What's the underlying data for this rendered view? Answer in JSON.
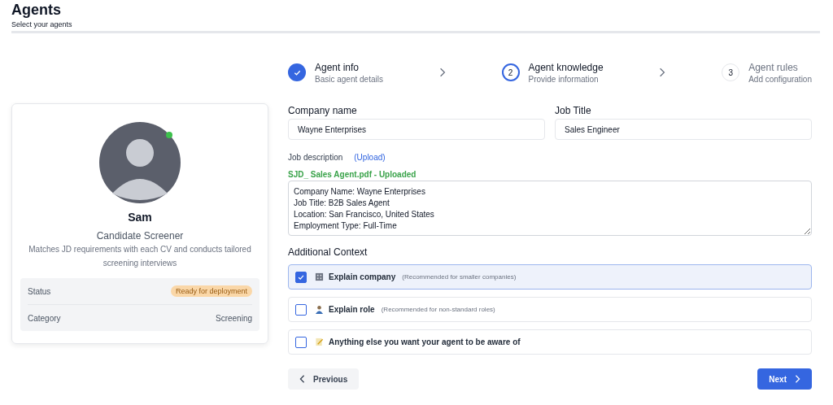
{
  "header": {
    "title": "Agents",
    "subtitle": "Select your agents"
  },
  "agent": {
    "online": true,
    "name": "Sam",
    "role": "Candidate Screener",
    "description": "Matches JD requirements with each CV and conducts tailored screening interviews",
    "details": [
      {
        "label": "Status",
        "value": "Ready for deployment",
        "kind": "badge"
      },
      {
        "label": "Category",
        "value": "Screening",
        "kind": "text"
      }
    ]
  },
  "steps": [
    {
      "title": "Agent info",
      "subtitle": "Basic agent details",
      "completed": true
    },
    {
      "number": "2",
      "title": "Agent knowledge",
      "subtitle": "Provide information",
      "completed": false,
      "active": true
    },
    {
      "number": "3",
      "title": "Agent rules",
      "subtitle": "Add configuration",
      "completed": false,
      "active": false
    }
  ],
  "fields": [
    {
      "label": "Company name",
      "value": "Wayne Enterprises"
    },
    {
      "label": "Job Title",
      "value": "Sales Engineer"
    }
  ],
  "job_description": {
    "label": "Job description",
    "upload_link": "(Upload)",
    "file_status": "SJD_ Sales Agent.pdf - Uploaded",
    "lines": [
      "Company Name: Wayne Enterprises",
      "Job Title: B2B Sales Agent",
      "Location: San Francisco, United States",
      "Employment Type: Full-Time"
    ]
  },
  "additional_context": {
    "title": "Additional Context",
    "options": [
      {
        "label": "Explain company",
        "hint": "(Recommended for smaller companies)",
        "checked": true
      },
      {
        "label": "Explain role",
        "hint": "(Recommended for non-standard roles)",
        "checked": false
      },
      {
        "label": "Anything else you want your agent to be aware of",
        "checked": false
      }
    ]
  },
  "buttons": {
    "previous": "Previous",
    "next": "Next"
  }
}
